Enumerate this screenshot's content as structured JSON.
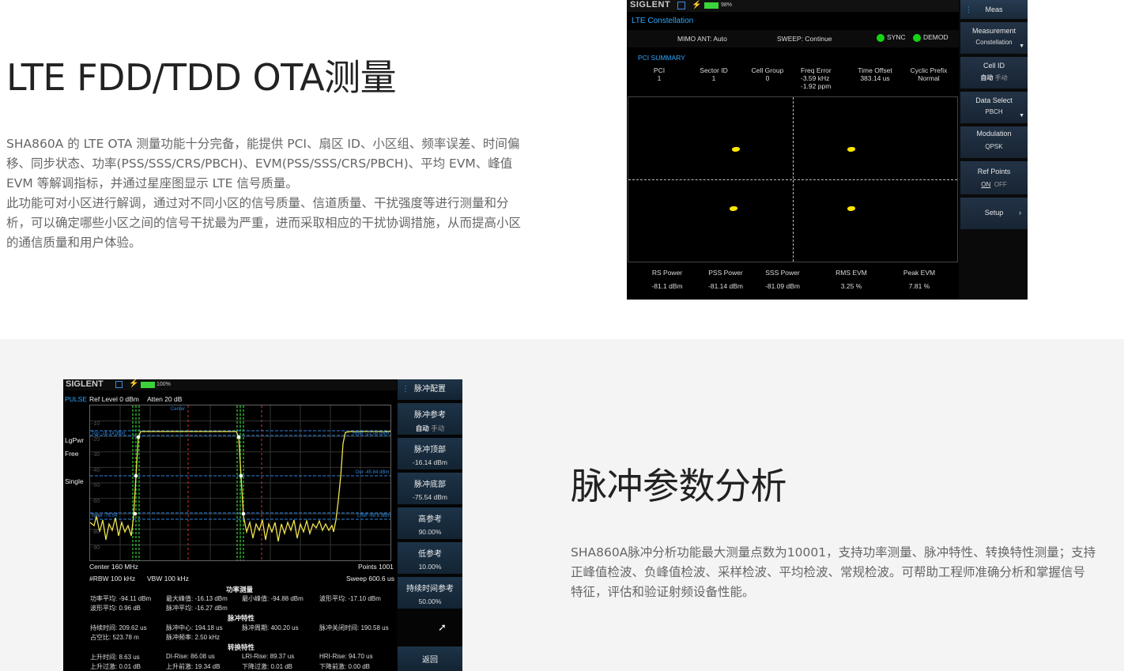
{
  "section1": {
    "heading": "LTE FDD/TDD OTA测量",
    "para_lines": [
      "SHA860A 的 LTE OTA 测量功能十分完备，能提供 PCI、扇区 ID、小区组、频率误差、时间偏",
      "移、同步状态、功率(PSS/SSS/CRS/PBCH)、EVM(PSS/SSS/CRS/PBCH)、平均 EVM、峰值",
      "EVM 等解调指标，并通过星座图显示 LTE 信号质量。",
      "此功能可对小区进行解调，通过对不同小区的信号质量、信道质量、干扰强度等进行测量和分",
      "析，可以确定哪些小区之间的信号干扰最为严重，进而采取相应的干扰协调措施，从而提高小区",
      "的通信质量和用户体验。"
    ],
    "screen": {
      "logo": "SIGLENT",
      "battery": "98%",
      "title": "LTE Constellation",
      "mimo": "MIMO ANT: Auto",
      "sweep": "SWEEP: Continue",
      "sync": "SYNC",
      "demod": "DEMOD",
      "pci_summary": "PCI SUMMARY",
      "cols": [
        {
          "h": "PCI",
          "v": "1"
        },
        {
          "h": "Sector ID",
          "v": "1"
        },
        {
          "h": "Cell Group",
          "v": "0"
        },
        {
          "h": "Freq Error",
          "v": "-3.59 kHz",
          "v2": "-1.92 ppm"
        },
        {
          "h": "Time Offset",
          "v": "383.14 us"
        },
        {
          "h": "Cyclic Prefix",
          "v": "Normal"
        }
      ],
      "bottom": [
        {
          "h": "RS Power",
          "v": "-81.1 dBm"
        },
        {
          "h": "PSS Power",
          "v": "-81.14 dBm"
        },
        {
          "h": "SSS Power",
          "v": "-81.09 dBm"
        },
        {
          "h": "RMS EVM",
          "v": "3.25 %"
        },
        {
          "h": "Peak EVM",
          "v": "7.81 %"
        }
      ],
      "menu": {
        "meas": "Meas",
        "measurement": "Measurement",
        "constellation": "Constellation",
        "cell_id": "Cell ID",
        "cell_auto": "自动",
        "cell_manual": "手动",
        "data_select": "Data Select",
        "pbch": "PBCH",
        "modulation": "Modulation",
        "qpsk": "QPSK",
        "ref_points": "Ref Points",
        "on": "ON",
        "off": "OFF",
        "setup": "Setup"
      }
    }
  },
  "section2": {
    "heading": "脉冲参数分析",
    "para_lines": [
      "SHA860A脉冲分析功能最大测量点数为10001，支持功率测量、脉冲特性、转换特性测量；支持",
      "正峰值检波、负峰值检波、采样检波、平均检波、常规检波。可帮助工程师准确分析和掌握信号",
      "特征，评估和验证射频设备性能。"
    ],
    "screen": {
      "logo": "SIGLENT",
      "battery": "100%",
      "mode": "PULSE",
      "ref_level": "Ref Level  0 dBm",
      "atten": "Atten  20 dB",
      "left_labels": [
        "LgPwr",
        "Free",
        "Single"
      ],
      "y_ticks": [
        "-10",
        "-20",
        "-30",
        "-40",
        "-50",
        "-60",
        "-70",
        "-80",
        "-90"
      ],
      "center_lbl": "Center",
      "top_lbl": "Top -16.14 dBm",
      "hr_lbl": "HRef -22.08 dBm",
      "dur_lbl": "Dur -45.84 dBm",
      "base_lbl": "Base -75.54",
      "lr_lbl": "LRef -69.6 dBm",
      "center": "Center  160 MHz",
      "points": "Points  1001",
      "rbw": "#RBW  100 kHz",
      "vbw": "VBW  100 kHz",
      "sweep": "Sweep  600.6 us",
      "sec_power": "功率测量",
      "sec_pulse": "脉冲特性",
      "sec_trans": "转换特性",
      "rows": [
        [
          "功率平均: -94.11 dBm",
          "最大峰值: -16.13 dBm",
          "最小峰值: -94.88 dBm",
          "波形平均: -17.10 dBm"
        ],
        [
          "波形平均: 0.96 dB",
          "脉冲平均: -16.27 dBm",
          "",
          ""
        ],
        [
          "持续时间: 209.62 us",
          "脉冲中心: 194.18 us",
          "脉冲周期: 400.20 us",
          "脉冲关闭时间: 190.58 us"
        ],
        [
          "占空比: 523.78 m",
          "脉冲频率: 2.50 kHz",
          "",
          ""
        ],
        [
          "上升时间: 8.63 us",
          "DI-Rise: 86.08 us",
          "LRI-Rise: 89.37 us",
          "HRI-Rise: 94.70 us"
        ],
        [
          "上升过激: 0.01 dB",
          "上升前激: 19.34 dB",
          "下降过激: 0.01 dB",
          "下降前激: 0.00 dB"
        ]
      ],
      "menu": {
        "title": "脉冲配置",
        "ref": "脉冲参考",
        "auto": "自动",
        "manual": "手动",
        "top": "脉冲顶部",
        "top_v": "-16.14 dBm",
        "bottom": "脉冲底部",
        "bottom_v": "-75.54 dBm",
        "high": "高参考",
        "high_v": "90.00%",
        "low": "低参考",
        "low_v": "10.00%",
        "dur_ref": "持续时间参考",
        "dur_v": "50.00%",
        "back": "返回"
      }
    }
  },
  "colors": {
    "accent_blue": "#2ea8ff",
    "yellow": "#ffe600",
    "green": "#14d414"
  }
}
